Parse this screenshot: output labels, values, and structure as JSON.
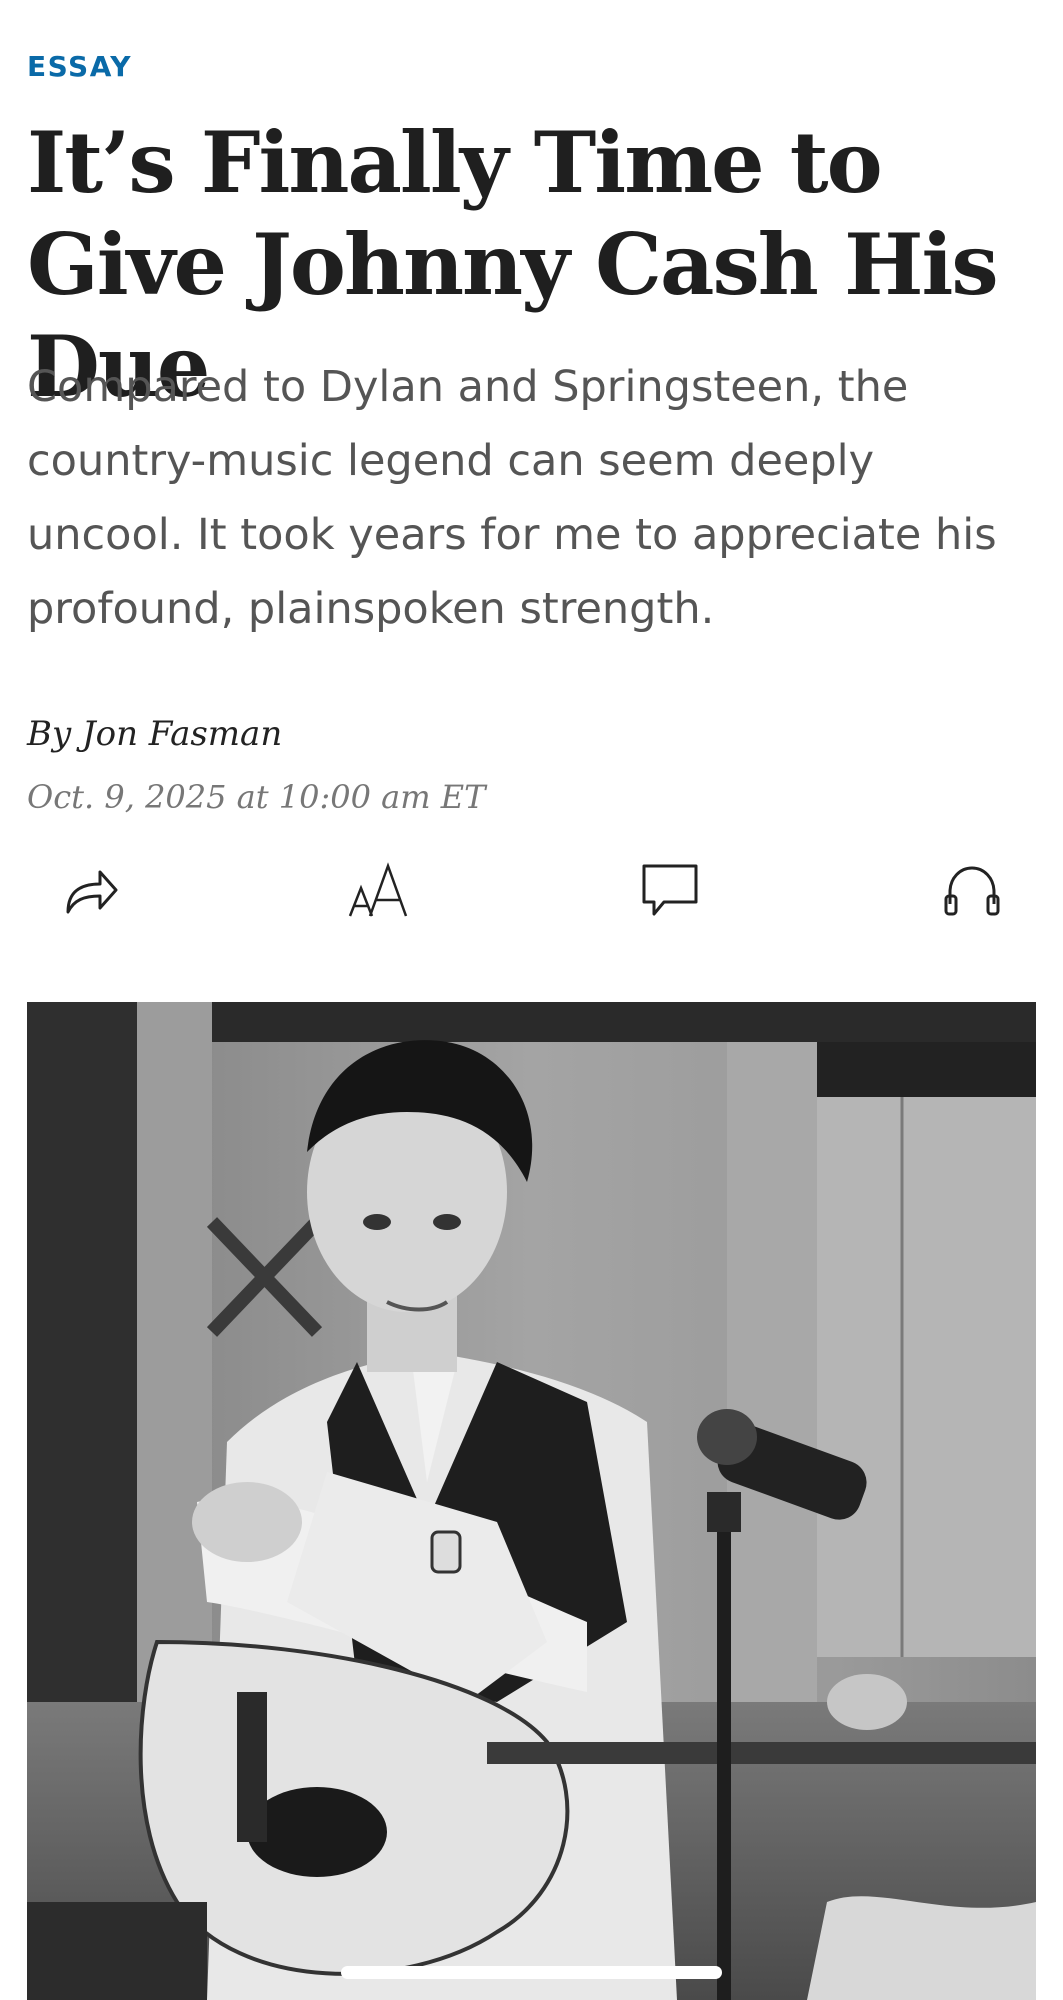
{
  "article": {
    "kicker": "ESSAY",
    "headline": "It’s Finally Time to Give Johnny Cash His Due",
    "dek": "Compared to Dylan and Springsteen, the country-music legend can seem deeply uncool. It took years for me to appreciate his profound, plainspoken strength.",
    "byline": "By Jon Fasman",
    "date": "Oct. 9, 2025 at 10:00 am ET"
  },
  "toolbar": [
    {
      "icon": "share-icon"
    },
    {
      "icon": "text-size-icon"
    },
    {
      "icon": "comment-icon"
    },
    {
      "icon": "headphones-icon"
    }
  ],
  "colors": {
    "kicker": "#0a6aa8",
    "headline": "#1f1f1f",
    "dek": "#555555",
    "date": "#777777"
  }
}
